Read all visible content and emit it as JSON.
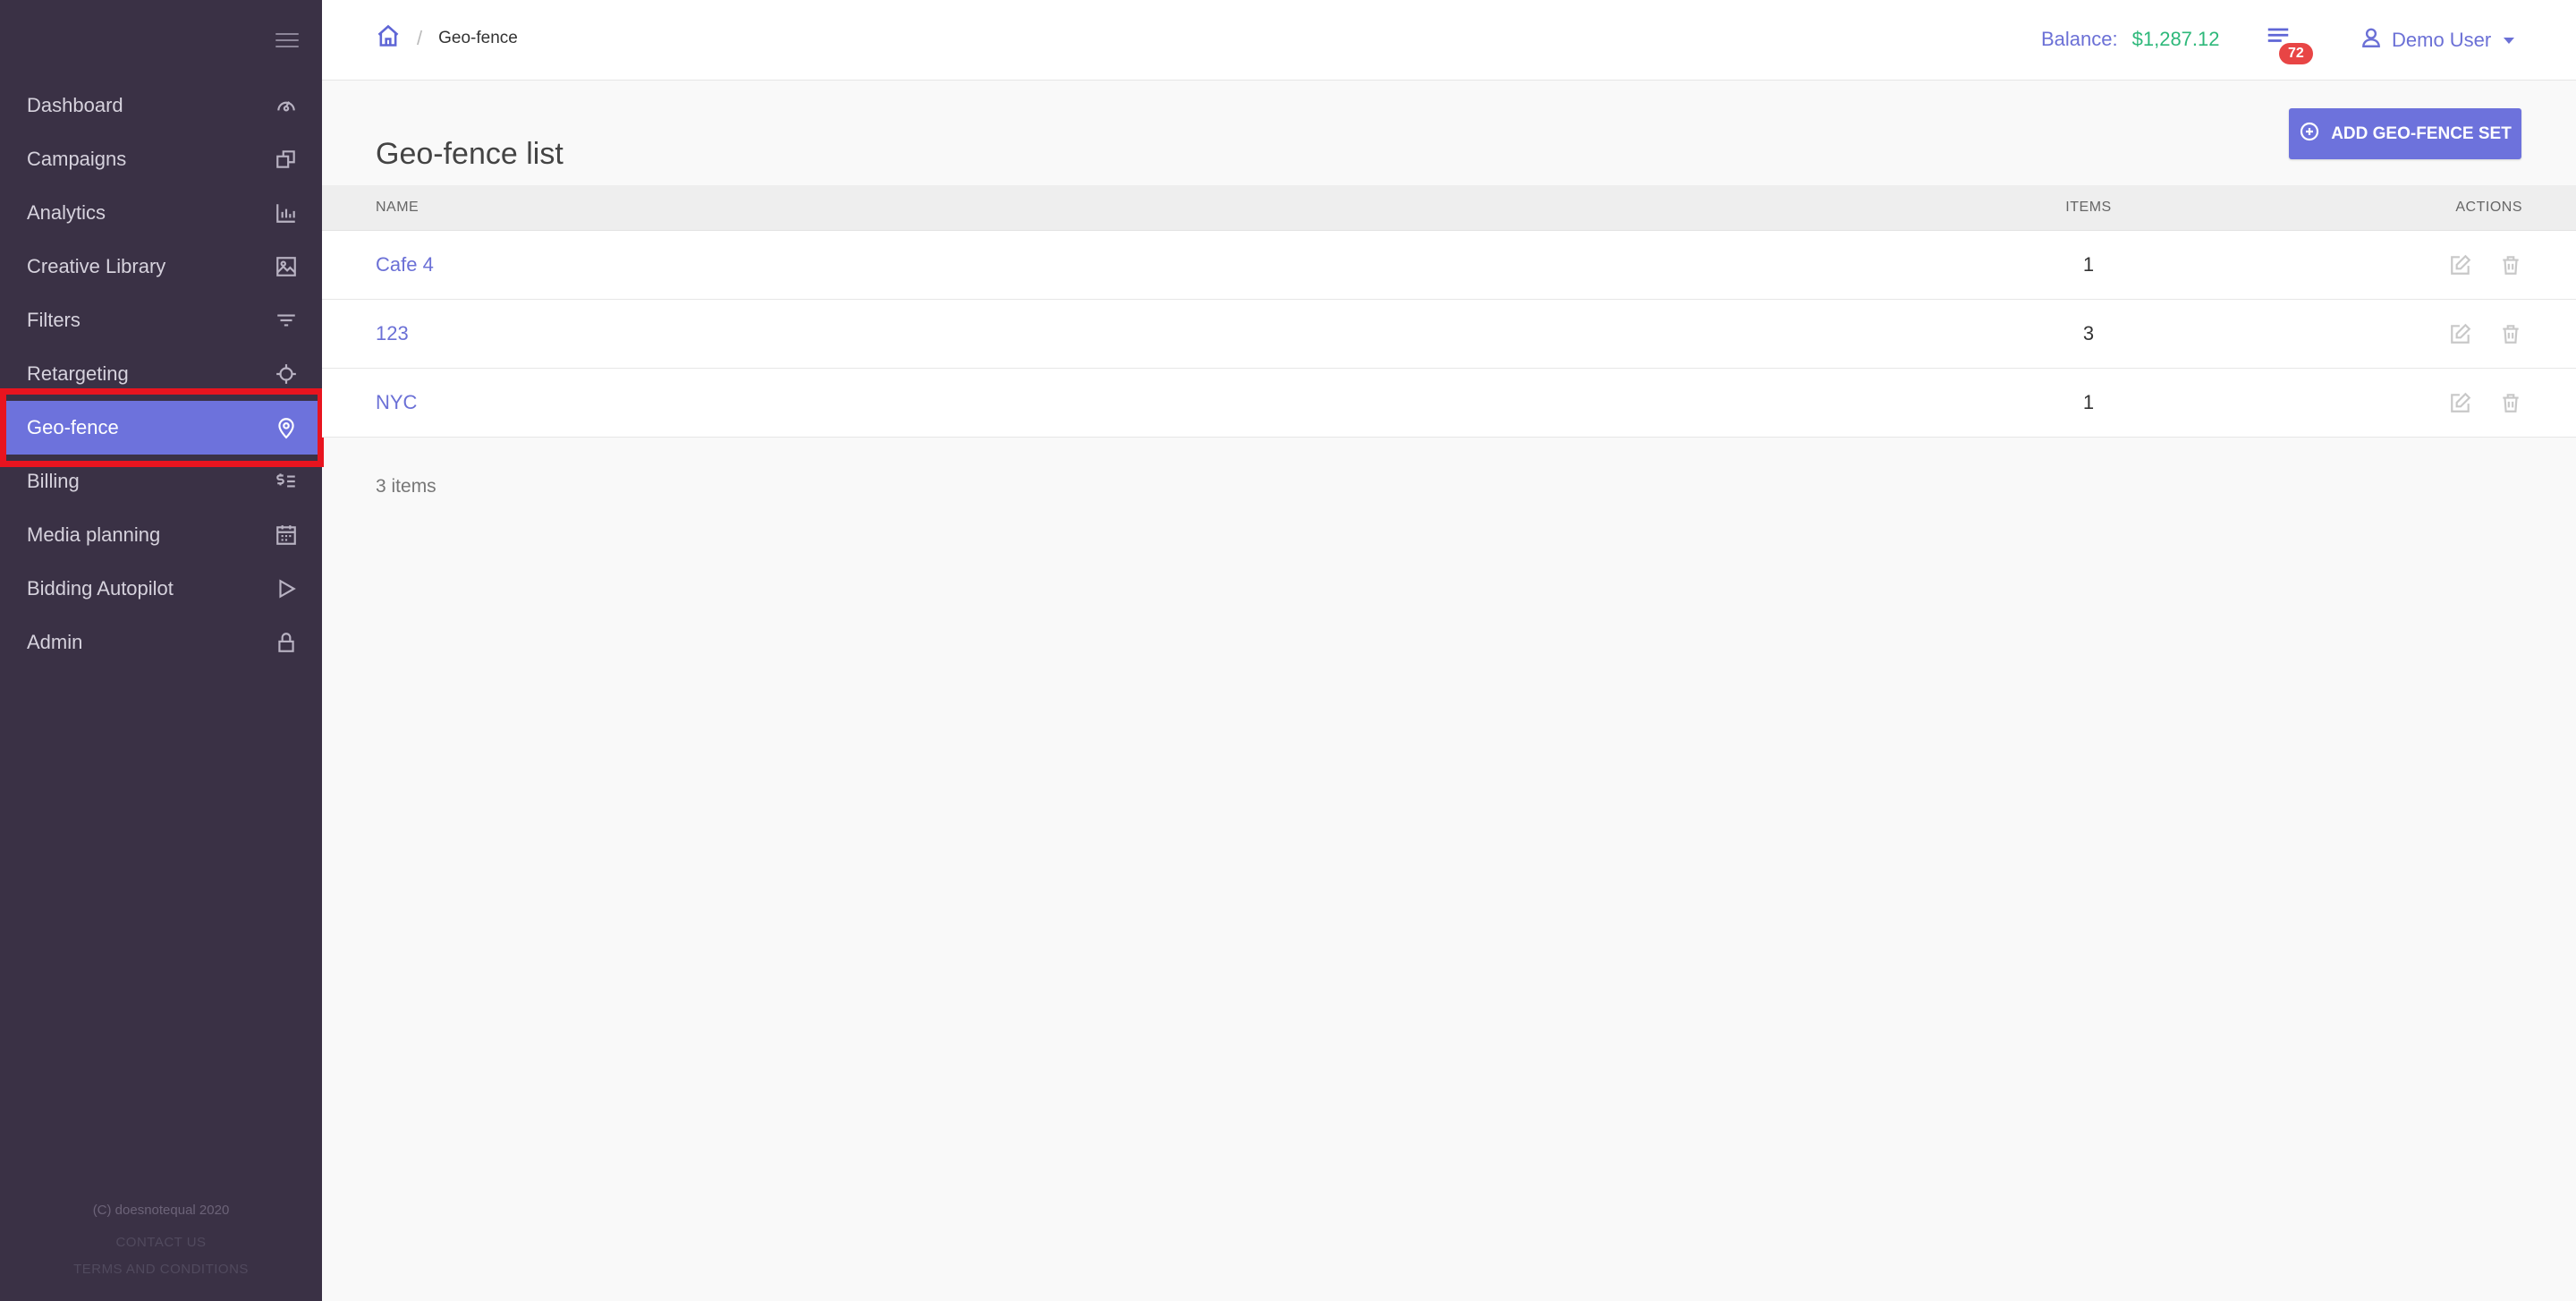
{
  "sidebar": {
    "items": [
      {
        "label": "Dashboard",
        "icon": "dashboard-icon"
      },
      {
        "label": "Campaigns",
        "icon": "campaigns-icon"
      },
      {
        "label": "Analytics",
        "icon": "analytics-icon"
      },
      {
        "label": "Creative Library",
        "icon": "image-icon"
      },
      {
        "label": "Filters",
        "icon": "filter-icon"
      },
      {
        "label": "Retargeting",
        "icon": "crosshair-icon"
      },
      {
        "label": "Geo-fence",
        "icon": "map-pin-icon",
        "active": true
      },
      {
        "label": "Billing",
        "icon": "billing-icon"
      },
      {
        "label": "Media planning",
        "icon": "calendar-icon"
      },
      {
        "label": "Bidding Autopilot",
        "icon": "play-icon"
      },
      {
        "label": "Admin",
        "icon": "lock-icon"
      }
    ],
    "footer": {
      "copyright": "(C) doesnotequal 2020",
      "contact": "CONTACT US",
      "terms": "TERMS AND CONDITIONS"
    }
  },
  "header": {
    "breadcrumb_current": "Geo-fence",
    "balance_label": "Balance:",
    "balance_amount": "$1,287.12",
    "notification_count": "72",
    "user_name": "Demo User"
  },
  "main": {
    "title": "Geo-fence list",
    "add_button_label": "ADD GEO-FENCE SET",
    "table": {
      "columns": [
        "NAME",
        "ITEMS",
        "ACTIONS"
      ],
      "rows": [
        {
          "name": "Cafe 4",
          "items": "1"
        },
        {
          "name": "123",
          "items": "3"
        },
        {
          "name": "NYC",
          "items": "1"
        }
      ]
    },
    "items_count": "3 items"
  },
  "colors": {
    "sidebar_bg": "#3a3145",
    "accent": "#6d72dc",
    "balance_amount": "#2db87a",
    "badge": "#e84545",
    "highlight": "#e8141f"
  }
}
